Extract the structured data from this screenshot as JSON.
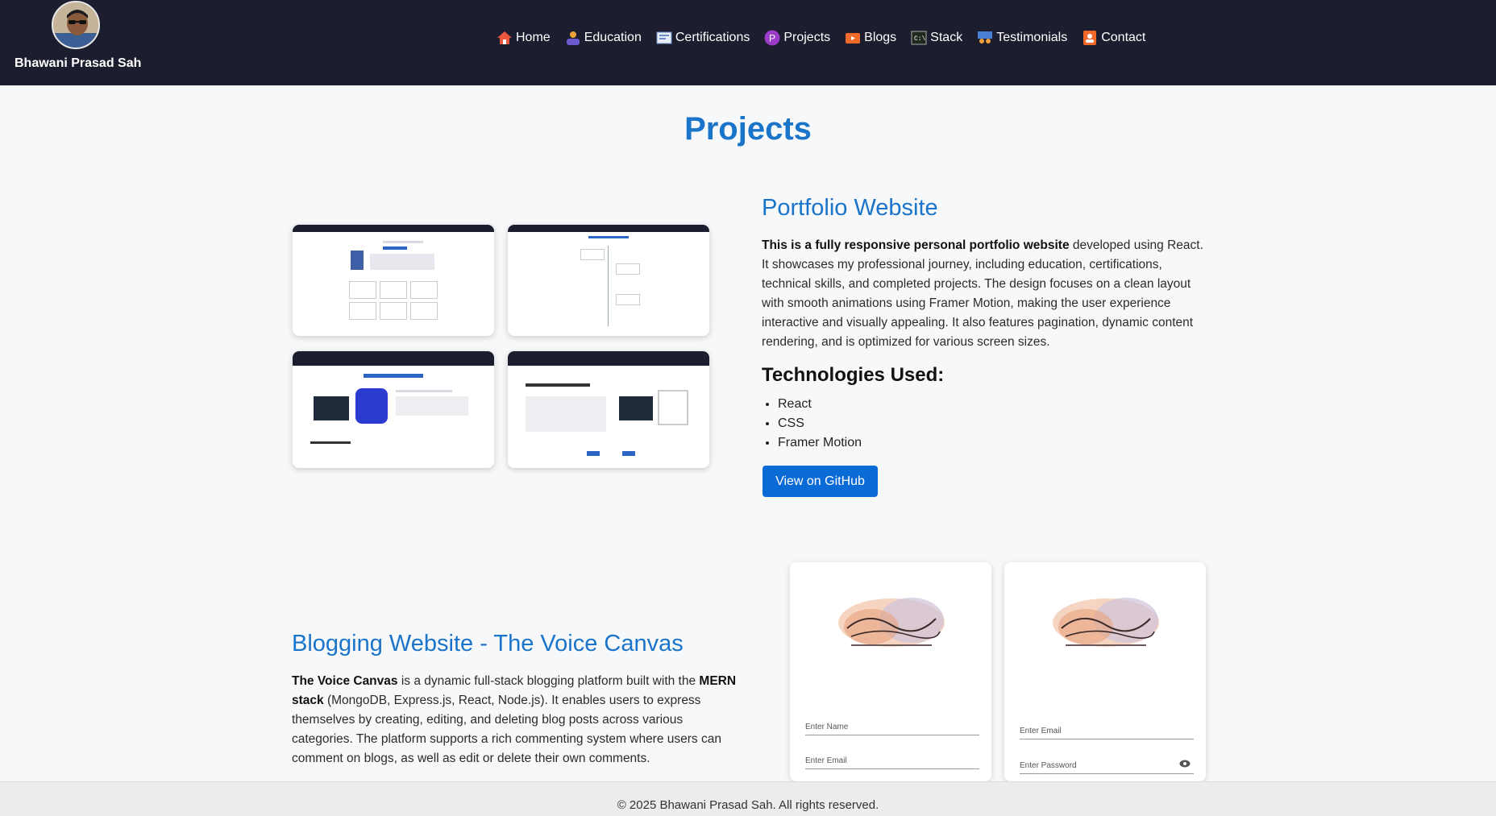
{
  "brand": {
    "name": "Bhawani Prasad Sah"
  },
  "nav": [
    {
      "label": "Home",
      "icon": "home-icon"
    },
    {
      "label": "Education",
      "icon": "education-icon"
    },
    {
      "label": "Certifications",
      "icon": "certificate-icon"
    },
    {
      "label": "Projects",
      "icon": "projects-icon"
    },
    {
      "label": "Blogs",
      "icon": "blogs-icon"
    },
    {
      "label": "Stack",
      "icon": "terminal-icon"
    },
    {
      "label": "Testimonials",
      "icon": "testimonials-icon"
    },
    {
      "label": "Contact",
      "icon": "contact-icon"
    }
  ],
  "page": {
    "title": "Projects"
  },
  "projects": [
    {
      "title": "Portfolio Website",
      "desc_bold": "This is a fully responsive personal portfolio website",
      "desc_rest": " developed using React. It showcases my professional journey, including education, certifications, technical skills, and completed projects. The design focuses on a clean layout with smooth animations using Framer Motion, making the user experience interactive and visually appealing. It also features pagination, dynamic content rendering, and is optimized for various screen sizes.",
      "tech_title": "Technologies Used:",
      "tech": [
        "React",
        "CSS",
        "Framer Motion"
      ],
      "button": "View on GitHub"
    },
    {
      "title": "Blogging Website - The Voice Canvas",
      "desc_bold1": "The Voice Canvas",
      "desc_mid": " is a dynamic full-stack blogging platform built with the ",
      "desc_bold2": "MERN stack",
      "desc_rest": " (MongoDB, Express.js, React, Node.js). It enables users to express themselves by creating, editing, and deleting blog posts across various categories. The platform supports a rich commenting system where users can comment on blogs, as well as edit or delete their own comments.",
      "signup": {
        "name_placeholder": "Enter Name",
        "email_placeholder": "Enter Email"
      },
      "login": {
        "email_placeholder": "Enter Email",
        "password_placeholder": "Enter Password"
      }
    }
  ],
  "footer": {
    "text": "© 2025 Bhawani Prasad Sah. All rights reserved."
  },
  "colors": {
    "navbar": "#1c1d2e",
    "accent": "#1a74c9",
    "button": "#0b6bd6"
  }
}
